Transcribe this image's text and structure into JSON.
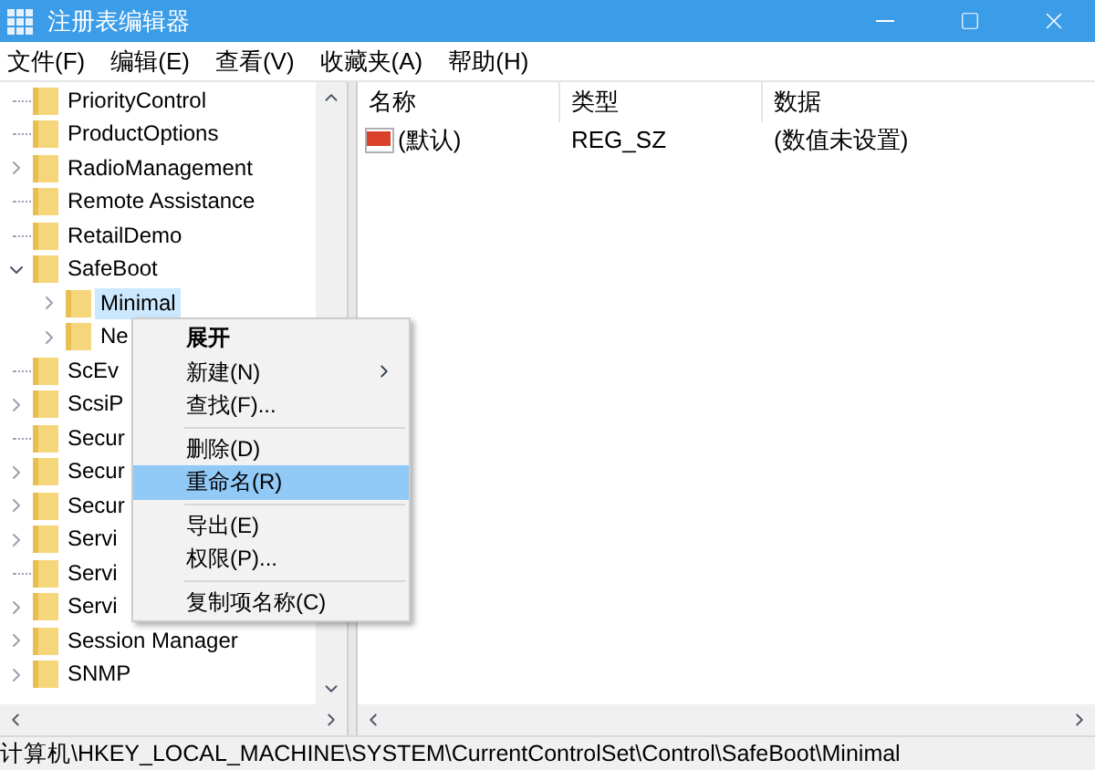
{
  "window": {
    "title": "注册表编辑器"
  },
  "menu_bar": [
    {
      "label": "文件(F)"
    },
    {
      "label": "编辑(E)"
    },
    {
      "label": "查看(V)"
    },
    {
      "label": "收藏夹(A)"
    },
    {
      "label": "帮助(H)"
    }
  ],
  "tree": [
    {
      "label": "PriorityControl",
      "kind": "leaf",
      "selected": false
    },
    {
      "label": "ProductOptions",
      "kind": "leaf",
      "selected": false
    },
    {
      "label": "RadioManagement",
      "kind": "node",
      "expanded": false,
      "selected": false
    },
    {
      "label": "Remote Assistance",
      "kind": "leaf",
      "selected": false
    },
    {
      "label": "RetailDemo",
      "kind": "leaf",
      "selected": false
    },
    {
      "label": "SafeBoot",
      "kind": "node",
      "expanded": true,
      "selected": false,
      "children": [
        {
          "label": "Minimal",
          "kind": "node",
          "expanded": false,
          "selected": true
        },
        {
          "label": "Ne",
          "kind": "node",
          "expanded": false,
          "selected": false
        }
      ]
    },
    {
      "label": "ScEv",
      "kind": "leaf",
      "selected": false
    },
    {
      "label": "ScsiP",
      "kind": "node",
      "expanded": false,
      "selected": false
    },
    {
      "label": "Secur",
      "kind": "leaf",
      "selected": false
    },
    {
      "label": "Secur",
      "kind": "node",
      "expanded": false,
      "selected": false
    },
    {
      "label": "Secur",
      "kind": "node",
      "expanded": false,
      "selected": false
    },
    {
      "label": "Servi",
      "kind": "node",
      "expanded": false,
      "selected": false
    },
    {
      "label": "Servi",
      "kind": "leaf",
      "selected": false
    },
    {
      "label": "Servi",
      "kind": "node",
      "expanded": false,
      "selected": false
    },
    {
      "label": "Session Manager",
      "kind": "node",
      "expanded": false,
      "selected": false
    },
    {
      "label": "SNMP",
      "kind": "node",
      "expanded": false,
      "selected": false
    }
  ],
  "values": {
    "columns": [
      "名称",
      "类型",
      "数据"
    ],
    "rows": [
      {
        "name": "(默认)",
        "type": "REG_SZ",
        "data": "(数值未设置)"
      }
    ]
  },
  "context_menu": [
    {
      "kind": "item",
      "label": "展开",
      "default": true,
      "submenu": false,
      "selected": false
    },
    {
      "kind": "item",
      "label": "新建(N)",
      "default": false,
      "submenu": true,
      "selected": false
    },
    {
      "kind": "item",
      "label": "查找(F)...",
      "default": false,
      "submenu": false,
      "selected": false
    },
    {
      "kind": "separator"
    },
    {
      "kind": "item",
      "label": "删除(D)",
      "default": false,
      "submenu": false,
      "selected": false
    },
    {
      "kind": "item",
      "label": "重命名(R)",
      "default": false,
      "submenu": false,
      "selected": true
    },
    {
      "kind": "separator"
    },
    {
      "kind": "item",
      "label": "导出(E)",
      "default": false,
      "submenu": false,
      "selected": false
    },
    {
      "kind": "item",
      "label": "权限(P)...",
      "default": false,
      "submenu": false,
      "selected": false
    },
    {
      "kind": "separator"
    },
    {
      "kind": "item",
      "label": "复制项名称(C)",
      "default": false,
      "submenu": false,
      "selected": false
    }
  ],
  "status_bar": {
    "path": "计算机\\HKEY_LOCAL_MACHINE\\SYSTEM\\CurrentControlSet\\Control\\SafeBoot\\Minimal"
  }
}
